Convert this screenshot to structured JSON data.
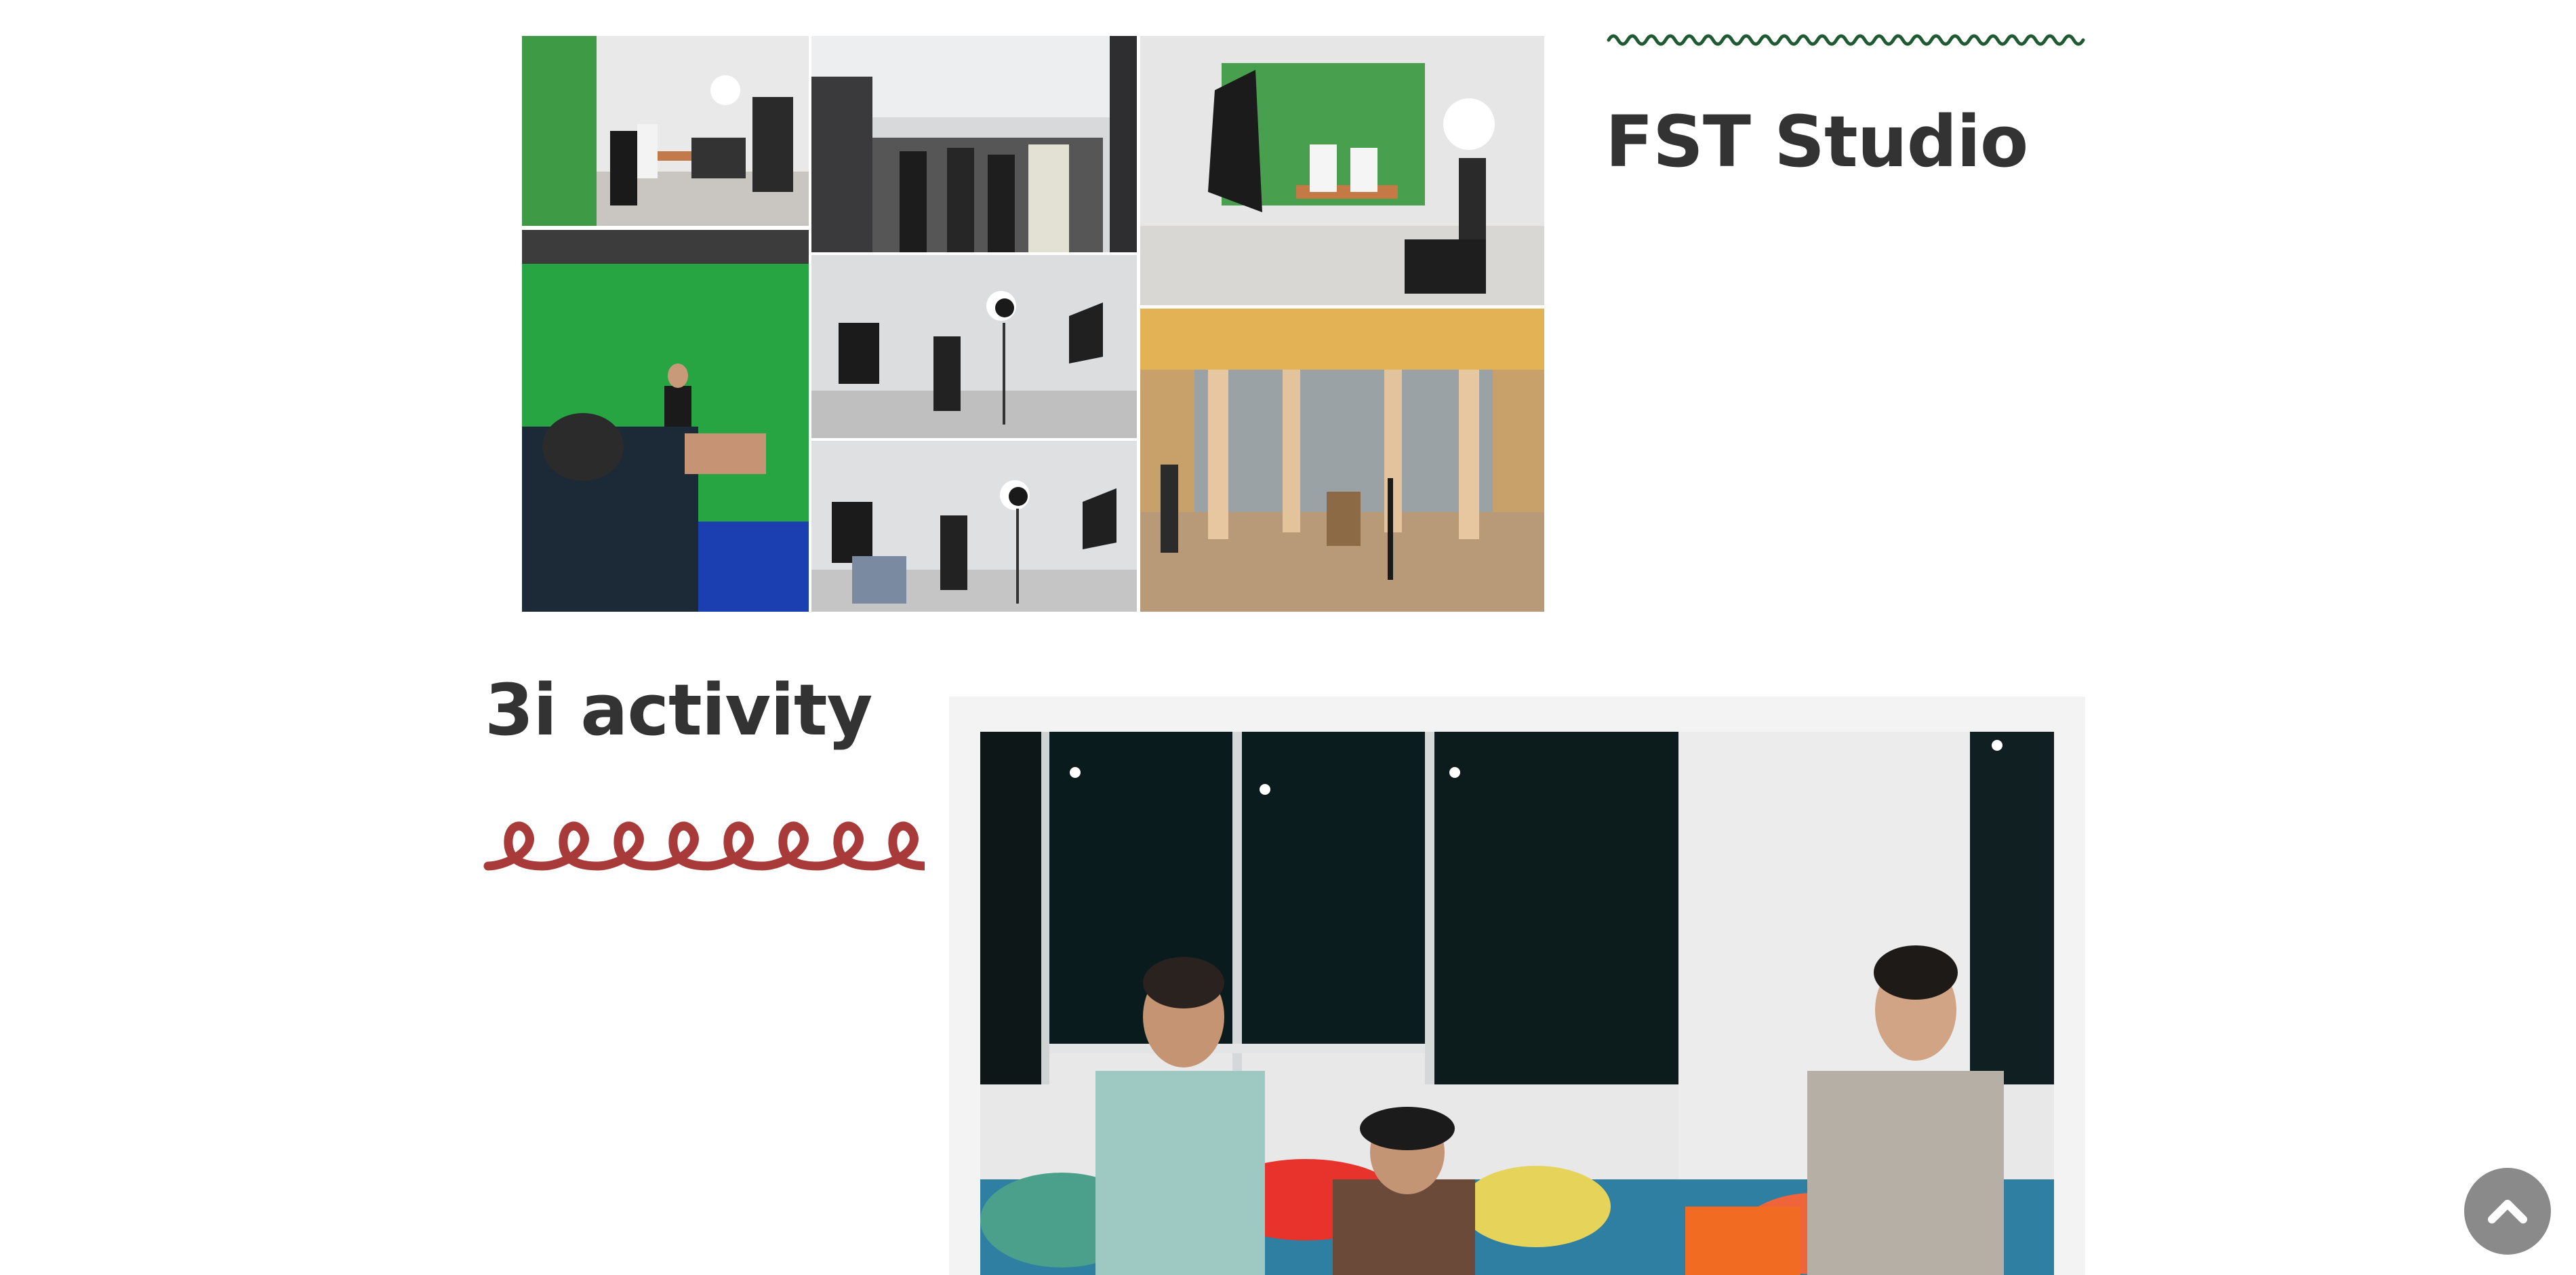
{
  "fst_studio": {
    "title": "FST Studio",
    "accent_color": "#1f5a33"
  },
  "activity": {
    "title": "3i activity",
    "accent_color": "#a83a3a"
  },
  "scroll_top": {
    "icon": "chevron-up-icon",
    "color": "#8a8a8a"
  }
}
